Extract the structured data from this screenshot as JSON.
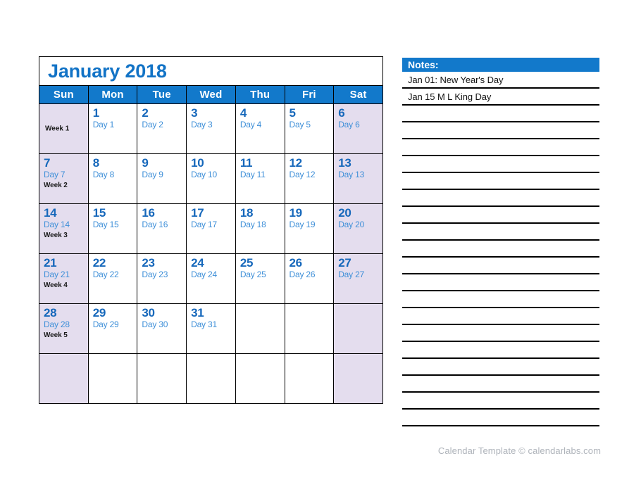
{
  "calendar": {
    "title": "January 2018",
    "weekday_headers": [
      "Sun",
      "Mon",
      "Tue",
      "Wed",
      "Thu",
      "Fri",
      "Sat"
    ],
    "weeks": [
      {
        "week_label": "Week 1",
        "cells": [
          {
            "num": "",
            "day": "",
            "week": "Week 1",
            "weekend": true,
            "empty": true
          },
          {
            "num": "1",
            "day": "Day 1",
            "weekend": false
          },
          {
            "num": "2",
            "day": "Day 2",
            "weekend": false
          },
          {
            "num": "3",
            "day": "Day 3",
            "weekend": false
          },
          {
            "num": "4",
            "day": "Day 4",
            "weekend": false
          },
          {
            "num": "5",
            "day": "Day 5",
            "weekend": false
          },
          {
            "num": "6",
            "day": "Day 6",
            "weekend": true
          }
        ]
      },
      {
        "week_label": "Week 2",
        "cells": [
          {
            "num": "7",
            "day": "Day 7",
            "week": "Week 2",
            "weekend": true
          },
          {
            "num": "8",
            "day": "Day 8",
            "weekend": false
          },
          {
            "num": "9",
            "day": "Day 9",
            "weekend": false
          },
          {
            "num": "10",
            "day": "Day 10",
            "weekend": false
          },
          {
            "num": "11",
            "day": "Day 11",
            "weekend": false
          },
          {
            "num": "12",
            "day": "Day 12",
            "weekend": false
          },
          {
            "num": "13",
            "day": "Day 13",
            "weekend": true
          }
        ]
      },
      {
        "week_label": "Week 3",
        "cells": [
          {
            "num": "14",
            "day": "Day 14",
            "week": "Week 3",
            "weekend": true
          },
          {
            "num": "15",
            "day": "Day 15",
            "weekend": false
          },
          {
            "num": "16",
            "day": "Day 16",
            "weekend": false
          },
          {
            "num": "17",
            "day": "Day 17",
            "weekend": false
          },
          {
            "num": "18",
            "day": "Day 18",
            "weekend": false
          },
          {
            "num": "19",
            "day": "Day 19",
            "weekend": false
          },
          {
            "num": "20",
            "day": "Day 20",
            "weekend": true
          }
        ]
      },
      {
        "week_label": "Week 4",
        "cells": [
          {
            "num": "21",
            "day": "Day 21",
            "week": "Week 4",
            "weekend": true
          },
          {
            "num": "22",
            "day": "Day 22",
            "weekend": false
          },
          {
            "num": "23",
            "day": "Day 23",
            "weekend": false
          },
          {
            "num": "24",
            "day": "Day 24",
            "weekend": false
          },
          {
            "num": "25",
            "day": "Day 25",
            "weekend": false
          },
          {
            "num": "26",
            "day": "Day 26",
            "weekend": false
          },
          {
            "num": "27",
            "day": "Day 27",
            "weekend": true
          }
        ]
      },
      {
        "week_label": "Week 5",
        "cells": [
          {
            "num": "28",
            "day": "Day 28",
            "week": "Week 5",
            "weekend": true
          },
          {
            "num": "29",
            "day": "Day 29",
            "weekend": false
          },
          {
            "num": "30",
            "day": "Day 30",
            "weekend": false
          },
          {
            "num": "31",
            "day": "Day 31",
            "weekend": false
          },
          {
            "num": "",
            "day": "",
            "weekend": false
          },
          {
            "num": "",
            "day": "",
            "weekend": false
          },
          {
            "num": "",
            "day": "",
            "weekend": true
          }
        ]
      },
      {
        "week_label": "",
        "cells": [
          {
            "num": "",
            "day": "",
            "weekend": true
          },
          {
            "num": "",
            "day": "",
            "weekend": false
          },
          {
            "num": "",
            "day": "",
            "weekend": false
          },
          {
            "num": "",
            "day": "",
            "weekend": false
          },
          {
            "num": "",
            "day": "",
            "weekend": false
          },
          {
            "num": "",
            "day": "",
            "weekend": false
          },
          {
            "num": "",
            "day": "",
            "weekend": true
          }
        ]
      }
    ]
  },
  "notes": {
    "header": "Notes:",
    "entries": [
      "Jan 01: New Year's Day",
      "Jan 15 M L King Day",
      "",
      "",
      "",
      "",
      "",
      "",
      "",
      "",
      "",
      "",
      "",
      "",
      "",
      "",
      "",
      "",
      "",
      "",
      ""
    ]
  },
  "footer": {
    "text": "Calendar Template © calendarlabs.com"
  },
  "colors": {
    "header_blue": "#1279CB",
    "title_blue": "#1273C6",
    "daynum_blue": "#1668BB",
    "daylabel_blue": "#3E8FD8",
    "weekend_lavender": "#E4DDEE",
    "footer_gray": "#AEB3BA",
    "rule_black": "#000000"
  }
}
